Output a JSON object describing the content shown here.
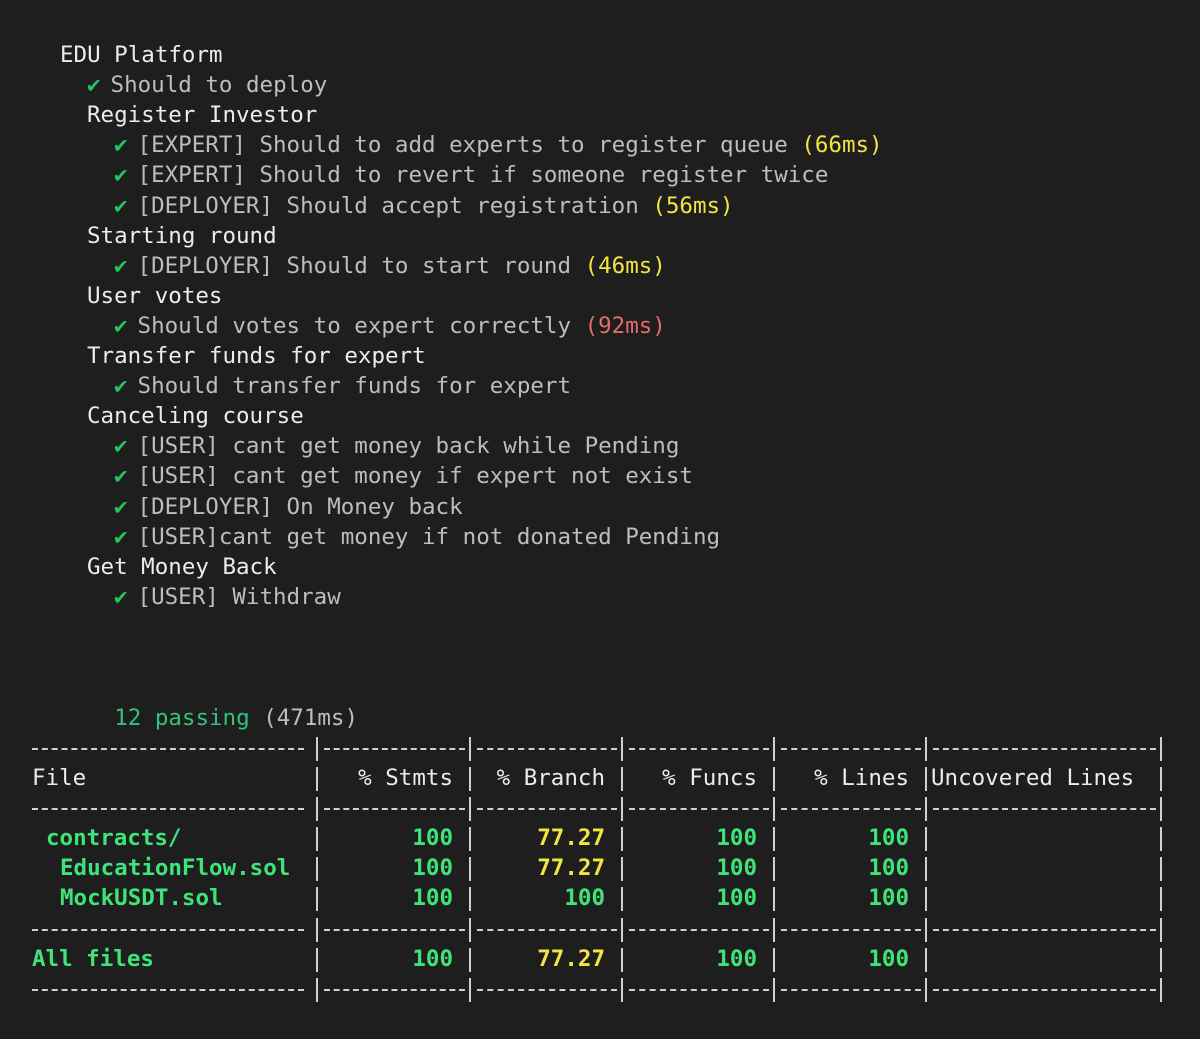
{
  "tests": [
    {
      "kind": "suite",
      "indent": 0,
      "text": "EDU Platform"
    },
    {
      "kind": "test",
      "indent": 1,
      "text": "Should to deploy",
      "dur": "",
      "durClass": ""
    },
    {
      "kind": "suite",
      "indent": 1,
      "text": "Register Investor"
    },
    {
      "kind": "test",
      "indent": 2,
      "text": "[EXPERT] Should to add experts to register queue",
      "dur": "(66ms)",
      "durClass": "yellow"
    },
    {
      "kind": "test",
      "indent": 2,
      "text": "[EXPERT] Should to revert if someone register twice",
      "dur": "",
      "durClass": ""
    },
    {
      "kind": "test",
      "indent": 2,
      "text": "[DEPLOYER] Should accept registration",
      "dur": "(56ms)",
      "durClass": "yellow"
    },
    {
      "kind": "suite",
      "indent": 1,
      "text": "Starting round"
    },
    {
      "kind": "test",
      "indent": 2,
      "text": "[DEPLOYER] Should to start round",
      "dur": "(46ms)",
      "durClass": "yellow"
    },
    {
      "kind": "suite",
      "indent": 1,
      "text": "User votes"
    },
    {
      "kind": "test",
      "indent": 2,
      "text": "Should votes to expert correctly",
      "dur": "(92ms)",
      "durClass": "red"
    },
    {
      "kind": "suite",
      "indent": 1,
      "text": "Transfer funds for expert"
    },
    {
      "kind": "test",
      "indent": 2,
      "text": "Should transfer funds for expert",
      "dur": "",
      "durClass": ""
    },
    {
      "kind": "suite",
      "indent": 1,
      "text": "Canceling course"
    },
    {
      "kind": "test",
      "indent": 2,
      "text": "[USER] cant get money back while Pending",
      "dur": "",
      "durClass": ""
    },
    {
      "kind": "test",
      "indent": 2,
      "text": "[USER] cant get money if expert not exist",
      "dur": "",
      "durClass": ""
    },
    {
      "kind": "test",
      "indent": 2,
      "text": "[DEPLOYER] On Money back",
      "dur": "",
      "durClass": ""
    },
    {
      "kind": "test",
      "indent": 2,
      "text": "[USER]cant get money if not donated Pending",
      "dur": "",
      "durClass": ""
    },
    {
      "kind": "suite",
      "indent": 1,
      "text": "Get Money Back"
    },
    {
      "kind": "test",
      "indent": 2,
      "text": "[USER] Withdraw",
      "dur": "",
      "durClass": ""
    }
  ],
  "checkmark": "✔",
  "summary": {
    "passing": "12 passing",
    "time": "(471ms)"
  },
  "coverage": {
    "headers": [
      "File",
      "% Stmts",
      "% Branch",
      "% Funcs",
      "% Lines",
      "Uncovered Lines"
    ],
    "rows": [
      {
        "file": "contracts/",
        "indent": 1,
        "stmts": "100",
        "branch": "77.27",
        "funcs": "100",
        "lines": "100",
        "uncovered": ""
      },
      {
        "file": "EducationFlow.sol",
        "indent": 2,
        "stmts": "100",
        "branch": "77.27",
        "funcs": "100",
        "lines": "100",
        "uncovered": ""
      },
      {
        "file": "MockUSDT.sol",
        "indent": 2,
        "stmts": "100",
        "branch": "100",
        "funcs": "100",
        "lines": "100",
        "uncovered": ""
      }
    ],
    "total": {
      "file": "All files",
      "stmts": "100",
      "branch": "77.27",
      "funcs": "100",
      "lines": "100",
      "uncovered": ""
    }
  },
  "colors": {
    "pass": "#22c55e",
    "yellow": "#f2e541",
    "red": "#e56a6a",
    "coverGreen": "#3ee37a"
  }
}
